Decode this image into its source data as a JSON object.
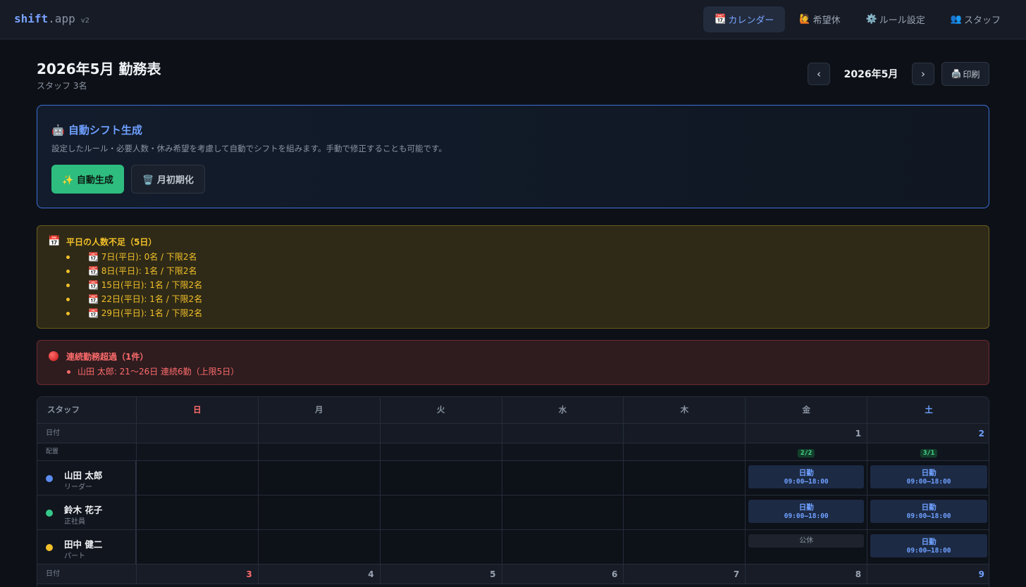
{
  "app": {
    "logo_main": "shift",
    "logo_dot": ".app",
    "version": "v2"
  },
  "nav": [
    {
      "icon": "📆",
      "label": "カレンダー"
    },
    {
      "icon": "🙋",
      "label": "希望休"
    },
    {
      "icon": "⚙️",
      "label": "ルール設定"
    },
    {
      "icon": "👥",
      "label": "スタッフ"
    }
  ],
  "header": {
    "title": "2026年5月 勤務表",
    "subtitle": "スタッフ 3名",
    "prev": "‹",
    "next": "›",
    "month": "2026年5月",
    "print_icon": "🖨️",
    "print_label": "印刷"
  },
  "auto": {
    "title": "🤖 自動シフト生成",
    "description": "設定したルール・必要人数・休み希望を考慮して自動でシフトを組みます。手動で修正することも可能です。",
    "generate_label": "✨ 自動生成",
    "reset_label": "🗑️ 月初期化"
  },
  "warning": {
    "icon": "📅",
    "title": "平日の人数不足（5日）",
    "items": [
      "📆 7日(平日): 0名 / 下限2名",
      "📆 8日(平日): 1名 / 下限2名",
      "📆 15日(平日): 1名 / 下限2名",
      "📆 22日(平日): 1名 / 下限2名",
      "📆 29日(平日): 1名 / 下限2名"
    ]
  },
  "error": {
    "title": "連続勤務超過（1件）",
    "items": [
      "山田 太郎: 21〜26日 連続6勤（上限5日）"
    ]
  },
  "calendar": {
    "staff_header": "スタッフ",
    "weekdays": [
      "日",
      "月",
      "火",
      "水",
      "木",
      "金",
      "土"
    ],
    "date_label": "日付",
    "alloc_label": "配置",
    "week1_dates": [
      "",
      "",
      "",
      "",
      "",
      "1",
      "2"
    ],
    "week1_alloc": [
      "",
      "",
      "",
      "",
      "",
      "2/2",
      "3/1"
    ],
    "week2_dates": [
      "3",
      "4",
      "5",
      "6",
      "7",
      "8",
      "9"
    ],
    "staff": [
      {
        "name": "山田 太郎",
        "role": "リーダー",
        "color": "#5b8def"
      },
      {
        "name": "鈴木 花子",
        "role": "正社員",
        "color": "#34c98a"
      },
      {
        "name": "田中 健二",
        "role": "パート",
        "color": "#f2c029"
      }
    ],
    "shift_label": "日勤",
    "shift_time": "09:00–18:00",
    "off_label": "公休"
  }
}
